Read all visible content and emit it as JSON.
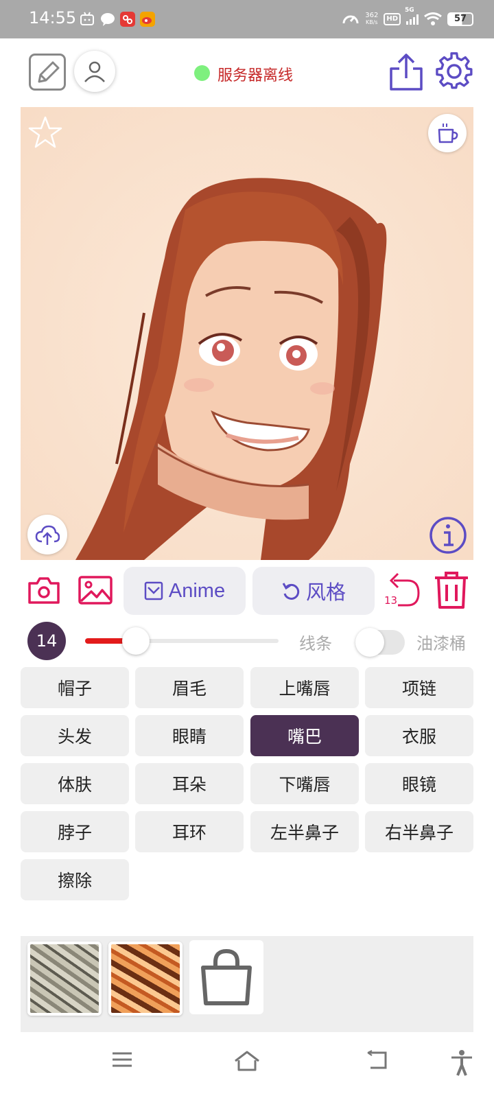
{
  "status_bar": {
    "time": "14:55",
    "speed_value": "362",
    "speed_unit": "KB/s",
    "hd": "HD",
    "network": "5G",
    "battery": "57"
  },
  "header": {
    "server_status": "服务器离线",
    "server_status_color": "#c62828",
    "status_dot_color": "#7ef07e"
  },
  "actions": {
    "anime_label": "Anime",
    "style_label": "风格",
    "undo_count": "13",
    "accent_color": "#e0185c",
    "pill_text_color": "#5c4cc4"
  },
  "brush": {
    "size": "14",
    "slider_level_percent": 26,
    "line_label": "线条",
    "bucket_label": "油漆桶",
    "bucket_enabled": false
  },
  "parts": [
    [
      "帽子",
      "眉毛",
      "上嘴唇",
      "项链"
    ],
    [
      "头发",
      "眼睛",
      "嘴巴",
      "衣服"
    ],
    [
      "体肤",
      "耳朵",
      "下嘴唇",
      "眼镜"
    ],
    [
      "脖子",
      "耳环",
      "左半鼻子",
      "右半鼻子"
    ],
    [
      "擦除"
    ]
  ],
  "selected_part": "嘴巴",
  "selected_color": "#4b3154",
  "icons": [
    "edit-icon",
    "user-icon",
    "share-icon",
    "gear-icon",
    "star-icon",
    "cup-icon",
    "upload-cloud-icon",
    "info-icon",
    "camera-icon",
    "image-icon",
    "undo-icon",
    "trash-icon",
    "bag-icon",
    "menu-icon",
    "home-icon",
    "back-icon",
    "accessibility-icon"
  ]
}
